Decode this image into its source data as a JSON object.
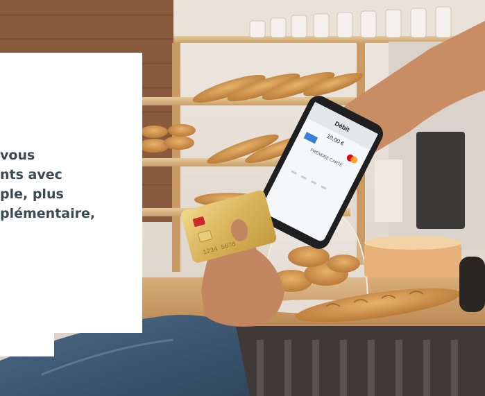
{
  "overlay": {
    "lines": [
      "vous",
      "nts avec",
      "ple, plus",
      "plémentaire,"
    ]
  },
  "phone_screen": {
    "header": "Débit",
    "amount": "10,00 €",
    "brand_label": "PRENDRE CARTE"
  },
  "card_text": "1234 5678"
}
